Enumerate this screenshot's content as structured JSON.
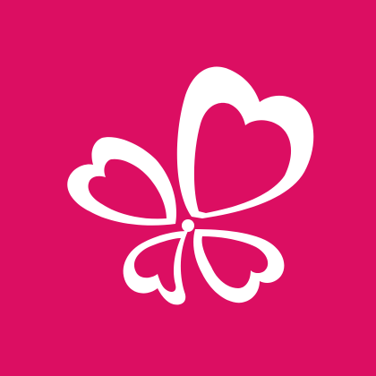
{
  "app_icon": {
    "icon": "heart-petal-clover-logo-icon",
    "colors": {
      "background": "#dc0e62",
      "mark": "#ffffff"
    }
  }
}
